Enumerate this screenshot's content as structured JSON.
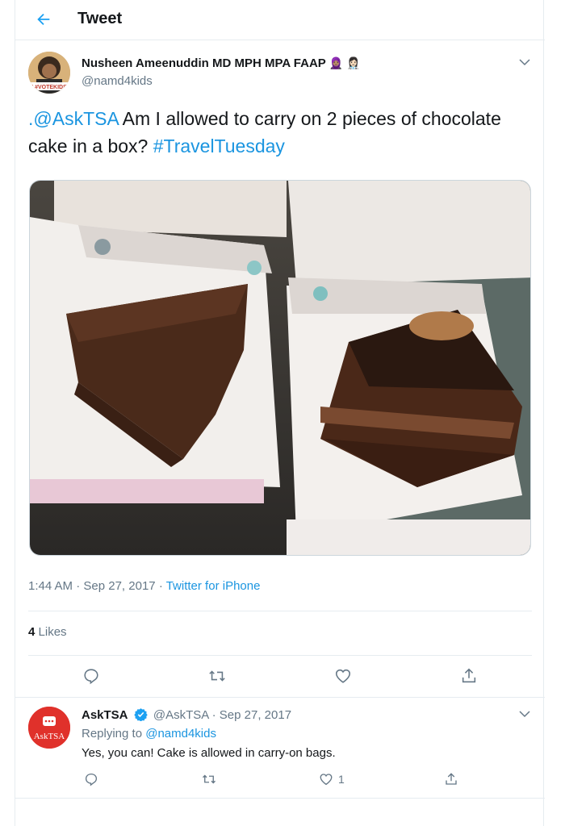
{
  "header": {
    "title": "Tweet"
  },
  "tweet": {
    "author_name": "Nusheen Ameenuddin MD MPH MPA FAAP",
    "author_emoji": "🧕🏽 👩🏻‍⚕️",
    "author_handle": "@namd4kids",
    "avatar_badge": "I #VOTEKIDS",
    "text_mention": ".@AskTSA",
    "text_body": " Am I allowed to carry on 2 pieces of chocolate cake in a box? ",
    "text_hashtag": "#TravelTuesday",
    "time": "1:44 AM",
    "date": "Sep 27, 2017",
    "source": "Twitter for iPhone",
    "likes_count": "4",
    "likes_label": "Likes"
  },
  "reply": {
    "author_name": "AskTSA",
    "author_handle": "@AskTSA",
    "date": "Sep 27, 2017",
    "replying_to_label": "Replying to",
    "replying_to_handle": "@namd4kids",
    "text": "Yes, you can! Cake is allowed in carry-on bags.",
    "avatar_text": "AskTSA",
    "like_count": "1"
  },
  "icons": [
    "back-arrow-icon",
    "chevron-down-icon",
    "reply-icon",
    "retweet-icon",
    "like-icon",
    "share-icon",
    "verified-icon"
  ],
  "colors": {
    "accent": "#1da1f2",
    "link": "#1b95e0",
    "muted": "#657786",
    "tsa_red": "#e0312b"
  }
}
